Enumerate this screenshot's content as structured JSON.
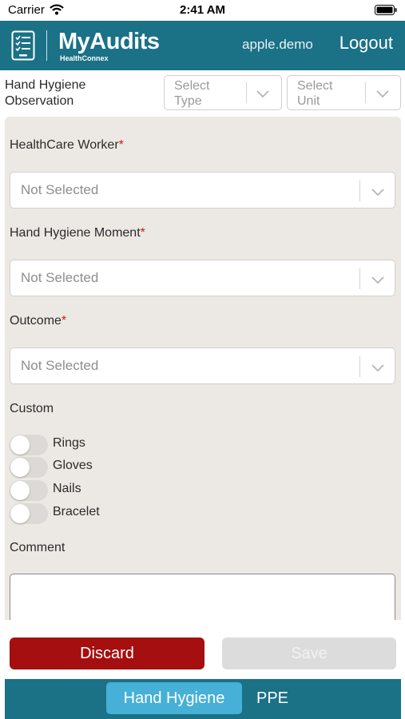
{
  "status_bar": {
    "carrier": "Carrier",
    "time": "2:41 AM"
  },
  "header": {
    "app_title": "MyAudits",
    "app_subtitle": "HealthConnex",
    "user": "apple.demo",
    "logout_label": "Logout",
    "background_color": "#1b7186"
  },
  "selectors": {
    "page_title_line1": "Hand Hygiene",
    "page_title_line2": "Observation",
    "type_line1": "Select",
    "type_line2": "Type",
    "unit_line1": "Select",
    "unit_line2": "Unit"
  },
  "form": {
    "healthcare_worker": {
      "label": "HealthCare Worker",
      "required_mark": "*",
      "value": "Not Selected"
    },
    "hand_hygiene_moment": {
      "label": "Hand Hygiene Moment",
      "required_mark": "*",
      "value": "Not Selected"
    },
    "outcome": {
      "label": "Outcome",
      "required_mark": "*",
      "value": "Not Selected"
    },
    "custom_label": "Custom",
    "toggles": [
      {
        "label": "Rings",
        "on": false
      },
      {
        "label": "Gloves",
        "on": false
      },
      {
        "label": "Nails",
        "on": false
      },
      {
        "label": "Bracelet",
        "on": false
      }
    ],
    "comment_label": "Comment",
    "comment_value": ""
  },
  "actions": {
    "discard_label": "Discard",
    "save_label": "Save",
    "discard_color": "#a50f0f"
  },
  "tabs": [
    {
      "label": "Hand Hygiene",
      "active": true
    },
    {
      "label": "PPE",
      "active": false
    }
  ],
  "icons": [
    "wifi-icon",
    "battery-icon",
    "checklist-icon",
    "chevron-down-icon"
  ]
}
